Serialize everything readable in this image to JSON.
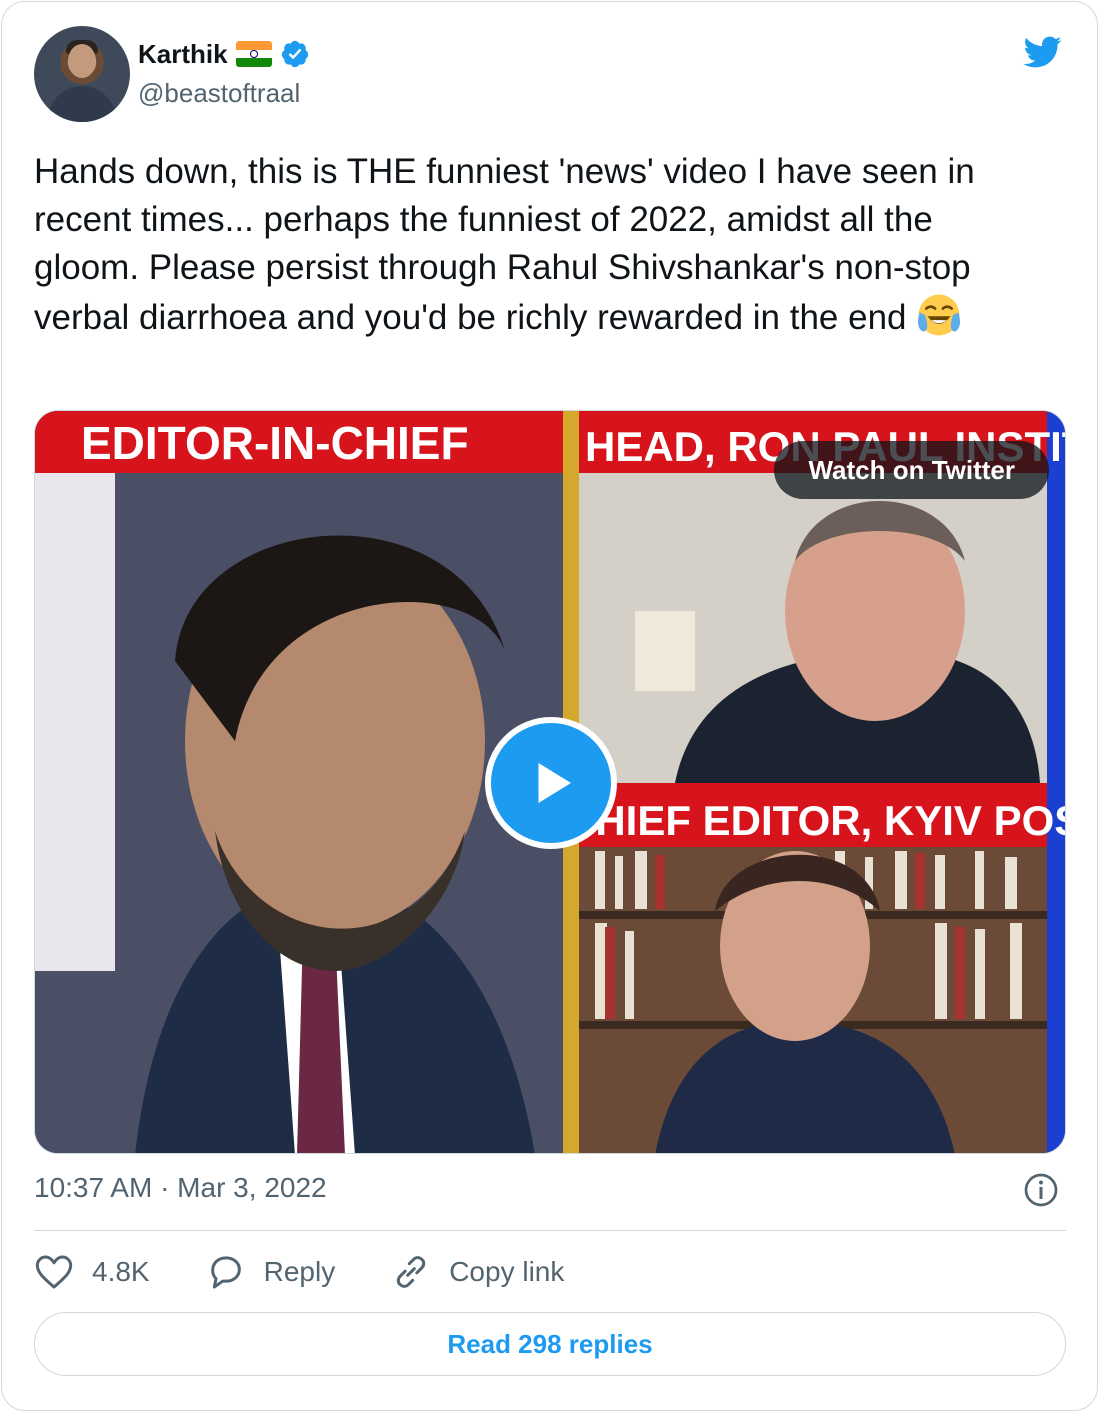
{
  "author": {
    "name": "Karthik",
    "handle": "@beastoftraal"
  },
  "tweet": {
    "text": "Hands down, this is THE funniest 'news' video I have seen in recent times... perhaps the funniest of 2022, amidst all the gloom. Please persist through Rahul Shivshankar's non-stop verbal diarrhoea and you'd be richly rewarded in the end",
    "emoji": "face-with-tears-of-joy"
  },
  "media": {
    "left_banner": "EDITOR-IN-CHIEF",
    "top_right_banner": "HEAD, RON PAUL INSTITUTE",
    "bottom_right_banner": "CHIEF EDITOR, KYIV POST",
    "watch_label": "Watch on Twitter"
  },
  "meta": {
    "timestamp": "10:37 AM · Mar 3, 2022"
  },
  "actions": {
    "likes": "4.8K",
    "reply_label": "Reply",
    "copy_label": "Copy link"
  },
  "read_replies_label": "Read 298 replies",
  "colors": {
    "accent": "#1d9bf0",
    "secondary_text": "#536471",
    "border": "#cfd9de"
  }
}
